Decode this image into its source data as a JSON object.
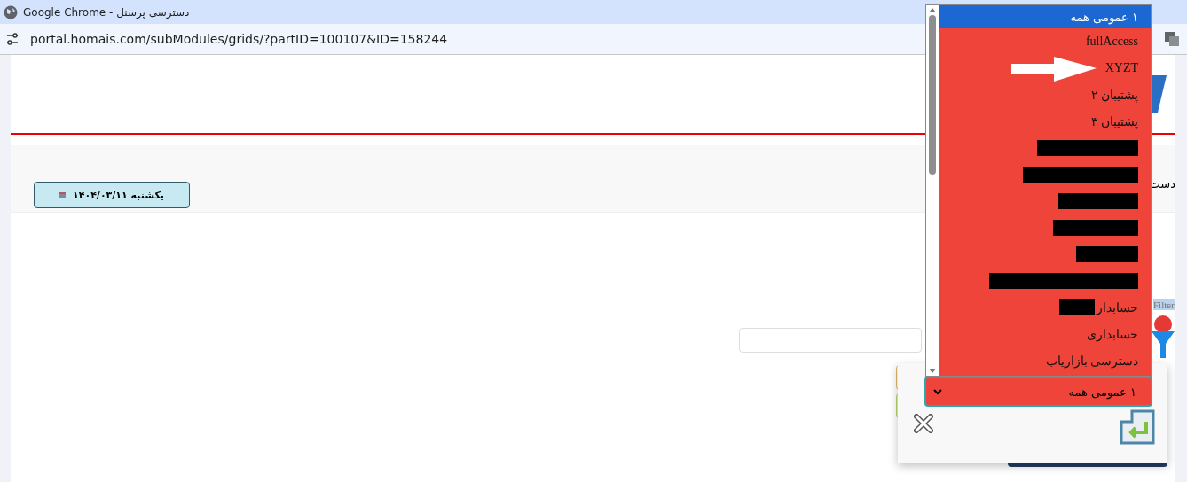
{
  "window": {
    "title": "Google Chrome - دسترسی پرسنل"
  },
  "address_bar": {
    "url": "portal.homais.com/subModules/grids/?partID=100107&ID=158244"
  },
  "header": {
    "date_button": "یکشنبه ۱۴۰۴/۰۳/۱۱",
    "heading": "دست"
  },
  "filter": {
    "label": "Filter"
  },
  "dropdown": {
    "value": "۱ عمومی همه",
    "expanded": true,
    "options": [
      {
        "kind": "text",
        "label": "۱ عمومی همه",
        "selected": true
      },
      {
        "kind": "text",
        "label": "fullAccess",
        "selected": false
      },
      {
        "kind": "text",
        "label": "XYZT",
        "selected": false
      },
      {
        "kind": "text",
        "label": "پشتیبان ۲",
        "selected": false
      },
      {
        "kind": "text",
        "label": "پشتیبان ۳",
        "selected": false
      },
      {
        "kind": "redacted",
        "selected": false
      },
      {
        "kind": "redacted",
        "selected": false
      },
      {
        "kind": "redacted",
        "selected": false
      },
      {
        "kind": "redacted",
        "selected": false
      },
      {
        "kind": "redacted",
        "selected": false
      },
      {
        "kind": "redacted",
        "selected": false
      },
      {
        "kind": "partly_redacted",
        "label": "حسابدار",
        "selected": false
      },
      {
        "kind": "text",
        "label": "حسابداری",
        "selected": false
      },
      {
        "kind": "text",
        "label": "دسترسی بازاریاب",
        "selected": false
      }
    ]
  }
}
